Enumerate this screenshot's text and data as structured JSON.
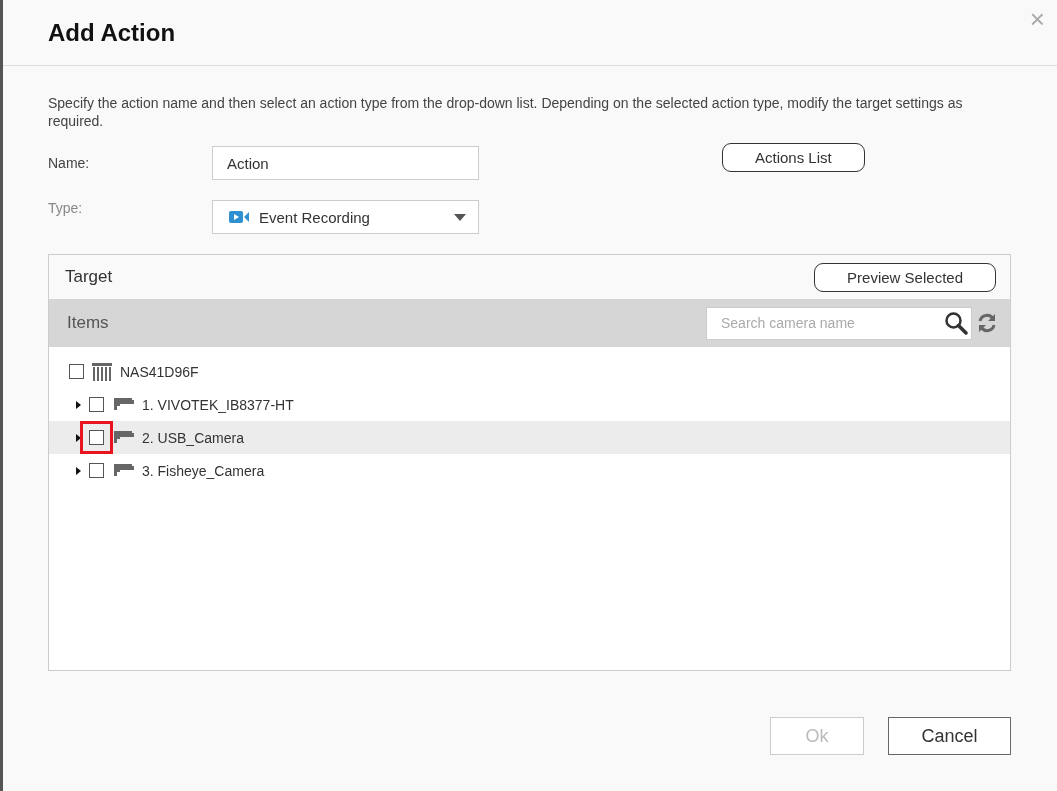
{
  "dialog": {
    "title": "Add Action",
    "close": "×"
  },
  "description": "Specify the action name and then select an action type from the drop-down list. Depending on the selected action type, modify the target settings as required.",
  "name_field": {
    "label": "Name:",
    "value": "Action"
  },
  "actions_list_button": "Actions List",
  "type_field": {
    "label": "Type:",
    "value": "Event Recording",
    "disabled": true
  },
  "target": {
    "title": "Target",
    "preview_button": "Preview Selected",
    "items_label": "Items",
    "search": {
      "placeholder": "Search camera name"
    },
    "tree": [
      {
        "label": "NAS41D96F",
        "checked": false,
        "selected": false,
        "children": [
          {
            "label": "1. VIVOTEK_IB8377-HT",
            "checked": false,
            "selected": false,
            "expanded": false,
            "highlighted": false
          },
          {
            "label": "2. USB_Camera",
            "checked": false,
            "selected": true,
            "expanded": false,
            "highlighted": true
          },
          {
            "label": "3. Fisheye_Camera",
            "checked": false,
            "selected": false,
            "expanded": false,
            "highlighted": false
          }
        ]
      }
    ]
  },
  "buttons": [
    {
      "label": "Ok",
      "disabled": true
    },
    {
      "label": "Cancel",
      "disabled": false
    }
  ]
}
